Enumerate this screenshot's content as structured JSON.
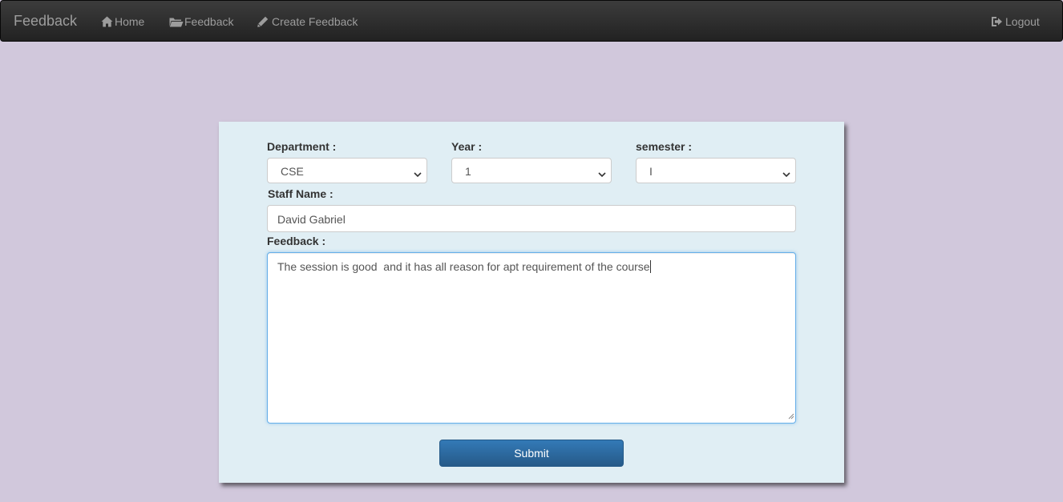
{
  "navbar": {
    "brand": "Feedback",
    "links": [
      {
        "label": "Home",
        "icon": "home-icon"
      },
      {
        "label": "Feedback",
        "icon": "folder-open-icon"
      },
      {
        "label": "Create Feedback",
        "icon": "pencil-icon"
      }
    ],
    "logout": {
      "label": "Logout",
      "icon": "logout-icon"
    }
  },
  "form": {
    "department": {
      "label": "Department :",
      "value": "CSE"
    },
    "year": {
      "label": "Year :",
      "value": "1"
    },
    "semester": {
      "label": "semester :",
      "value": "I"
    },
    "staff_name": {
      "label": "Staff Name :",
      "value": "David Gabriel"
    },
    "feedback": {
      "label": "Feedback :",
      "value": "The session is good  and it has all reason for apt requirement of the course"
    },
    "submit_label": "Submit"
  },
  "colors": {
    "page_background": "#d1c8dc",
    "navbar": "#222222",
    "card_background": "#e0eef4",
    "primary_button": "#337ab7",
    "focus_border": "#66afe9"
  }
}
